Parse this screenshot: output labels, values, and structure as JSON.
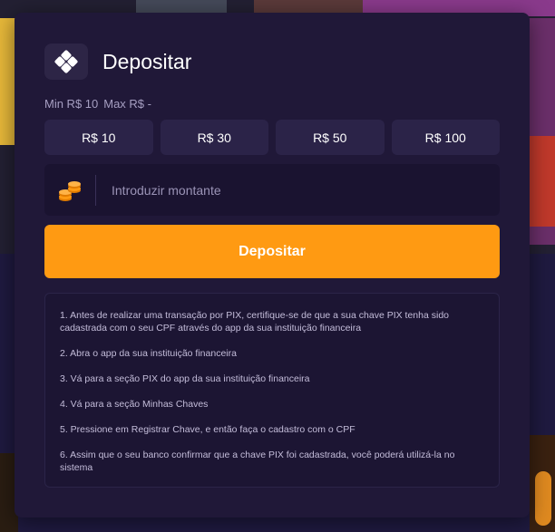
{
  "modal": {
    "title": "Depositar",
    "limits": {
      "min": "Min R$ 10",
      "max": "Max R$ -"
    },
    "quick_amounts": [
      "R$ 10",
      "R$ 30",
      "R$ 50",
      "R$ 100"
    ],
    "amount_input": {
      "placeholder": "Introduzir montante",
      "value": ""
    },
    "deposit_button": "Depositar",
    "instructions": [
      "1. Antes de realizar uma transação por PIX, certifique-se de que a sua chave PIX tenha sido cadastrada com o seu CPF através do app da sua instituição financeira",
      "2. Abra o app da sua instituição financeira",
      "3. Vá para a seção PIX do app da sua instituição financeira",
      "4. Vá para a seção Minhas Chaves",
      "5. Pressione em Registrar Chave, e então faça o cadastro com o CPF",
      "6. Assim que o seu banco confirmar que a chave PIX foi cadastrada, você poderá utilizá-la no sistema"
    ]
  },
  "icons": {
    "logo": "pix-logo-icon",
    "coins": "coins-icon"
  },
  "colors": {
    "accent": "#ff9a12",
    "modal_bg": "#201838",
    "button_bg": "#2b2348"
  }
}
